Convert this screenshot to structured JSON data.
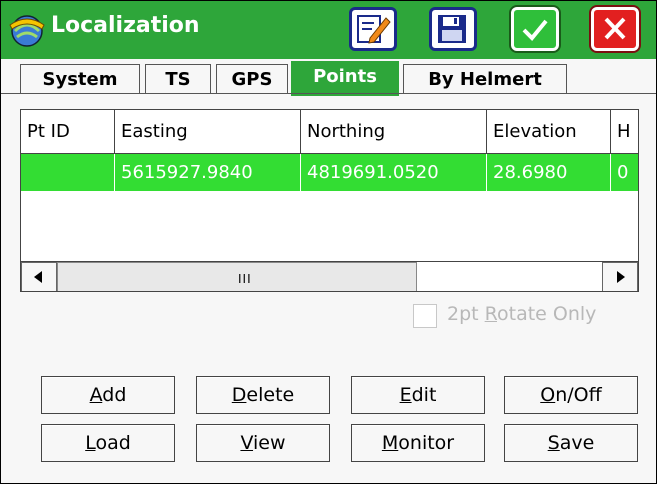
{
  "window": {
    "title": "Localization"
  },
  "titlebar_buttons": [
    {
      "name": "edit-icon"
    },
    {
      "name": "floppy-disk-icon"
    },
    {
      "name": "checkmark-icon"
    },
    {
      "name": "close-icon"
    }
  ],
  "tabs": [
    {
      "label": "System",
      "active": false
    },
    {
      "label": "TS",
      "active": false
    },
    {
      "label": "GPS",
      "active": false
    },
    {
      "label": "Points",
      "active": true
    },
    {
      "label": "By Helmert",
      "active": false
    }
  ],
  "table": {
    "headers": [
      "Pt ID",
      "Easting",
      "Northing",
      "Elevation",
      "H"
    ],
    "rows": [
      {
        "pt_id": "",
        "easting": "5615927.9840",
        "northing": "4819691.0520",
        "elevation": "28.6980",
        "h": "0"
      }
    ],
    "scroll_grip": "III"
  },
  "checkbox": {
    "label_prefix": "2pt ",
    "label_mnemonic": "R",
    "label_rest": "otate Only",
    "checked": false,
    "enabled": false
  },
  "buttons": [
    {
      "id": "add",
      "mn": "A",
      "rest": "dd"
    },
    {
      "id": "delete",
      "mn": "D",
      "rest": "elete"
    },
    {
      "id": "edit",
      "mn": "E",
      "rest": "dit"
    },
    {
      "id": "onoff",
      "mn": "O",
      "rest": "n/Off"
    },
    {
      "id": "load",
      "mn": "L",
      "rest": "oad"
    },
    {
      "id": "view",
      "mn": "V",
      "rest": "iew"
    },
    {
      "id": "monitor",
      "mn": "M",
      "rest": "onitor"
    },
    {
      "id": "save",
      "mn": "S",
      "rest": "ave"
    }
  ],
  "colors": {
    "titlebar": "#2ea63a",
    "selected_row": "#33dd33",
    "close": "#e22020"
  }
}
